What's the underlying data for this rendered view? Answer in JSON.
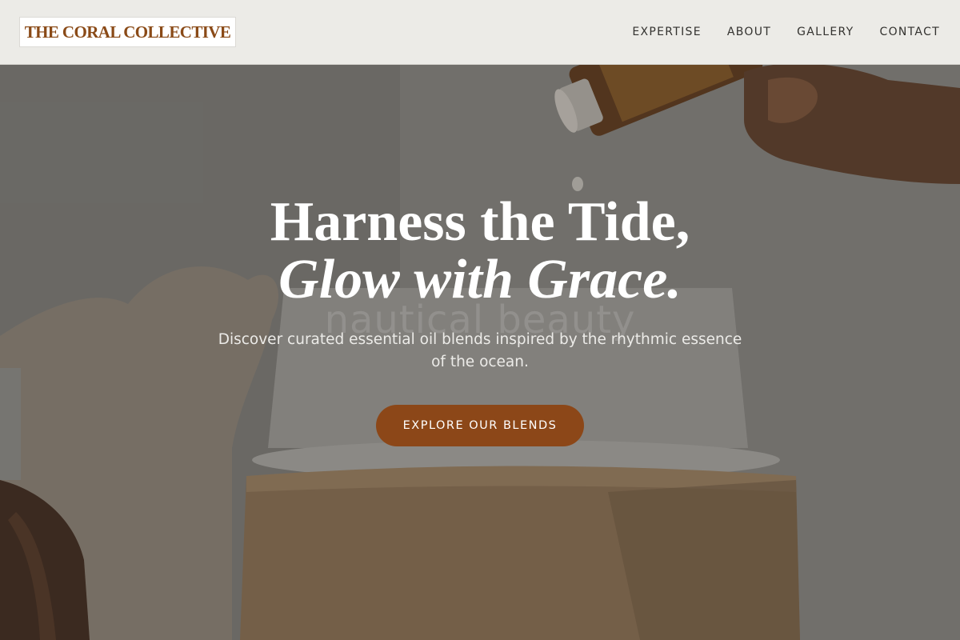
{
  "brand": {
    "name": "THE CORAL COLLECTIVE",
    "color": "#8a4a17"
  },
  "nav": {
    "items": [
      {
        "label": "EXPERTISE"
      },
      {
        "label": "ABOUT"
      },
      {
        "label": "GALLERY"
      },
      {
        "label": "CONTACT"
      }
    ]
  },
  "hero": {
    "headline_line1": "Harness the Tide,",
    "headline_line2": "Glow with Grace.",
    "ghost_text": "nautical beauty",
    "subtitle": "Discover curated essential oil blends inspired by the rhythmic essence of the ocean.",
    "cta_label": "EXPLORE OUR BLENDS",
    "cta_color": "#8c4718"
  }
}
